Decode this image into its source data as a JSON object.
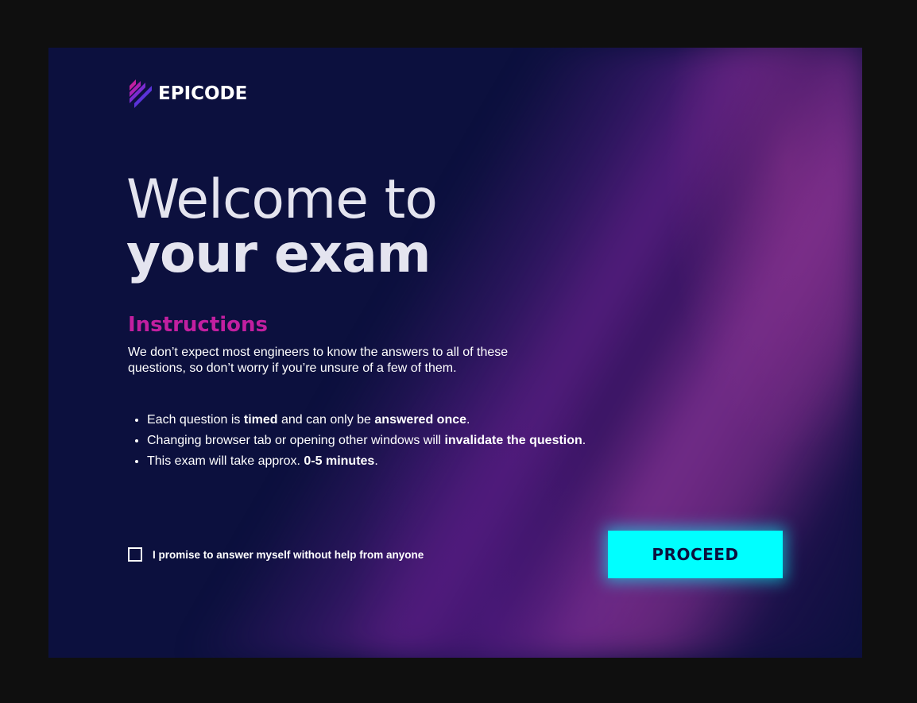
{
  "brand": {
    "name": "EPICODE",
    "logo_icon": "epicode-stripes-icon",
    "colors": {
      "background": "#0c103e",
      "accent_magenta": "#c21fa0",
      "accent_cyan": "#00ffff",
      "text": "#ffffff"
    }
  },
  "headline": {
    "line1": "Welcome to",
    "line2": "your exam"
  },
  "instructions": {
    "title": "Instructions",
    "text": "We don’t expect most engineers to know the answers to all of these questions, so don’t worry if you’re unsure of a few of them."
  },
  "rules": [
    {
      "pre": "Each question is ",
      "b1": "timed",
      "mid": " and can only be ",
      "b2": "answered once",
      "post": "."
    },
    {
      "pre": "Changing browser tab or opening other windows will ",
      "b1": "invalidate the question",
      "post": "."
    },
    {
      "pre": "This exam will take approx. ",
      "b1": "0-5 minutes",
      "post": "."
    }
  ],
  "consent": {
    "checked": false,
    "label": "I promise to answer myself without help from anyone"
  },
  "actions": {
    "proceed_label": "PROCEED"
  }
}
